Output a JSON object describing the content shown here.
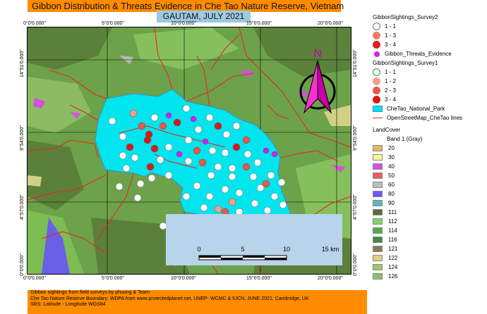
{
  "title": "Gibbon Distribution & Threats Evidence in Che Tao Nature Reserve, Vietnam",
  "subtitle": "GAUTAM, JULY 2021",
  "coords": {
    "top": [
      "0°0'0.000\"",
      "5°0'0.000\"",
      "10°0'0.000\"",
      "15°0'0.000\"",
      "20°0'0.000\""
    ],
    "bottom": [
      "0°0'0.000\"",
      "5°0'0.000\"",
      "10°0'0.000\"",
      "15°0'0.000\"",
      "20°0'0.000\""
    ],
    "left": [
      "14°51'0.000\"",
      "9°54'0.000\"",
      "4°57'0.000\"",
      "0°0'0.000\""
    ],
    "right": [
      "14°51'0.000\"",
      "9°54'0.000\"",
      "4°57'0.000\"",
      "0°0'0.000\""
    ]
  },
  "north_label": "N",
  "scale": {
    "ticks": [
      "0",
      "5",
      "10",
      "15 km"
    ]
  },
  "legend": {
    "survey2_title": "GibbonSightings_Survey2",
    "survey2_items": [
      {
        "label": "1 - 1",
        "color": "#ffffff"
      },
      {
        "label": "1 - 3",
        "color": "#f07a6a"
      },
      {
        "label": "3 - 4",
        "color": "#e0201a"
      }
    ],
    "threats_label": "Gibbon_Threats_Evidence",
    "threats_color": "#cc22ee",
    "survey1_title": "GibbonSightings_Survey1",
    "survey1_items": [
      {
        "label": "1 - 1",
        "color": "#ffffff"
      },
      {
        "label": "1 - 2",
        "color": "#f2a08a"
      },
      {
        "label": "2 - 3",
        "color": "#e8584a"
      },
      {
        "label": "3 - 4",
        "color": "#d7191c"
      }
    ],
    "park_label": "CheTao_National_Park",
    "park_color": "#00e5ee",
    "osm_label": "OpenStreetMap_CheTao lines",
    "osm_color": "#e8281e",
    "landcover_title": "LandCover",
    "band_label": "Band 1 (Gray)",
    "landcover_items": [
      {
        "label": "20",
        "color": "#e8b36a"
      },
      {
        "label": "30",
        "color": "#fff59a"
      },
      {
        "label": "40",
        "color": "#d94fe0"
      },
      {
        "label": "50",
        "color": "#f05a5a"
      },
      {
        "label": "60",
        "color": "#bdbdbd"
      },
      {
        "label": "80",
        "color": "#6a5cf0"
      },
      {
        "label": "90",
        "color": "#58b8c8"
      },
      {
        "label": "111",
        "color": "#5c6a3a"
      },
      {
        "label": "112",
        "color": "#7fd46a"
      },
      {
        "label": "114",
        "color": "#4fae4a"
      },
      {
        "label": "116",
        "color": "#3f8a3c"
      },
      {
        "label": "121",
        "color": "#8a7a52"
      },
      {
        "label": "122",
        "color": "#d7d48a"
      },
      {
        "label": "124",
        "color": "#9ac86a"
      },
      {
        "label": "126",
        "color": "#8fbf6a"
      }
    ]
  },
  "footer": [
    "Gibbon sightings from field surveys by phuong & Team",
    "Che Tao Nature Reserve Boundary: WDPA from www.protectedplanet.net, UNEP- WCMC & IUCN, JUNE 2021, Cambridge, UK",
    "SRS: Latitude - Longitude WGS84"
  ]
}
